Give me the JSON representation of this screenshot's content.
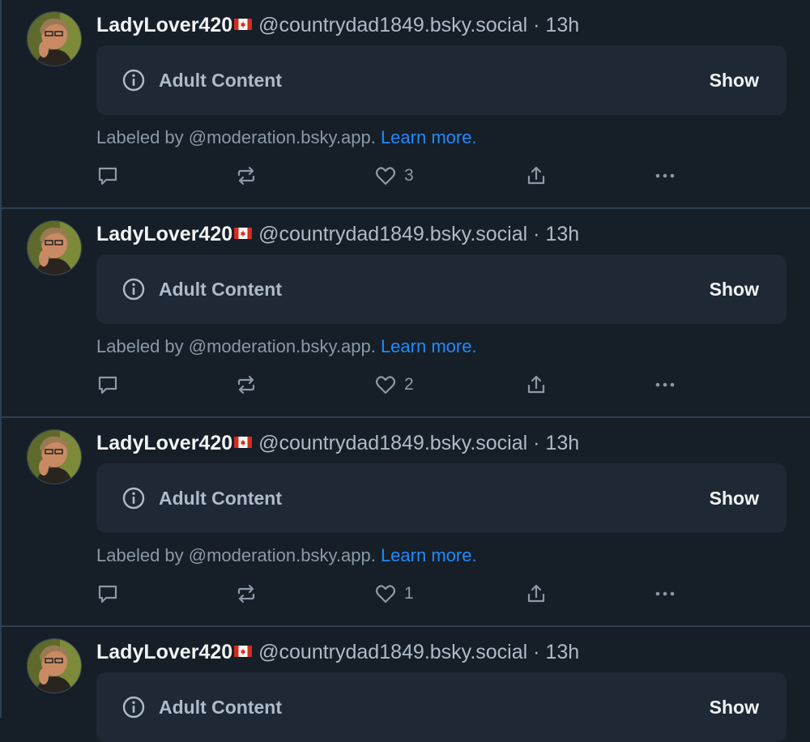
{
  "posts": [
    {
      "author_name": "LadyLover420",
      "flag": "canada-flag",
      "handle": "@countrydad1849.bsky.social",
      "separator": "·",
      "time": "13h",
      "warning_label": "Adult Content",
      "show_label": "Show",
      "labeled_by": "Labeled by @moderation.bsky.app.",
      "learn_more": "Learn more.",
      "like_count": "3"
    },
    {
      "author_name": "LadyLover420",
      "flag": "canada-flag",
      "handle": "@countrydad1849.bsky.social",
      "separator": "·",
      "time": "13h",
      "warning_label": "Adult Content",
      "show_label": "Show",
      "labeled_by": "Labeled by @moderation.bsky.app.",
      "learn_more": "Learn more.",
      "like_count": "2"
    },
    {
      "author_name": "LadyLover420",
      "flag": "canada-flag",
      "handle": "@countrydad1849.bsky.social",
      "separator": "·",
      "time": "13h",
      "warning_label": "Adult Content",
      "show_label": "Show",
      "labeled_by": "Labeled by @moderation.bsky.app.",
      "learn_more": "Learn more.",
      "like_count": "1"
    },
    {
      "author_name": "LadyLover420",
      "flag": "canada-flag",
      "handle": "@countrydad1849.bsky.social",
      "separator": "·",
      "time": "13h",
      "warning_label": "Adult Content",
      "show_label": "Show"
    }
  ],
  "icons": {
    "reply": "reply-bubble-icon",
    "repost": "repost-icon",
    "like": "heart-icon",
    "share": "share-icon",
    "more": "more-dots-icon",
    "info": "info-circle-icon"
  },
  "colors": {
    "background": "#161e27",
    "card": "#1e2935",
    "link": "#208bfe",
    "muted": "#8b99a8",
    "text": "#f1f3f5"
  }
}
